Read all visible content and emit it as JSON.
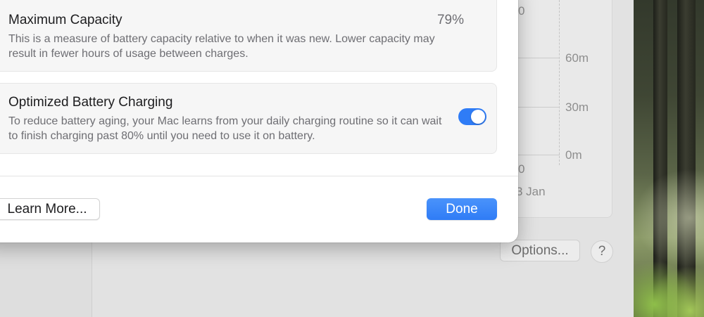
{
  "battery_sheet": {
    "maximum_capacity": {
      "title": "Maximum Capacity",
      "value": "79%",
      "description": "This is a measure of battery capacity relative to when it was new. Lower capacity may result in fewer hours of usage between charges."
    },
    "optimized_charging": {
      "title": "Optimized Battery Charging",
      "description": "To reduce battery aging, your Mac learns from your daily charging routine so it can wait to finish charging past 80% until you need to use it on battery.",
      "enabled": true
    },
    "learn_more_label": "Learn More...",
    "done_label": "Done"
  },
  "background": {
    "chart": {
      "y_ticks": [
        "60m",
        "30m",
        "0m"
      ],
      "partial_ticks": [
        "0",
        "0"
      ],
      "date_label": "3 Jan"
    },
    "options_label": "Options...",
    "help_label": "?"
  },
  "colors": {
    "accent": "#2f7cf6",
    "sheet_background": "#ffffff",
    "panel_background": "#f6f6f6"
  },
  "icons": {
    "help": "question-mark-icon",
    "toggle": "toggle-switch"
  }
}
